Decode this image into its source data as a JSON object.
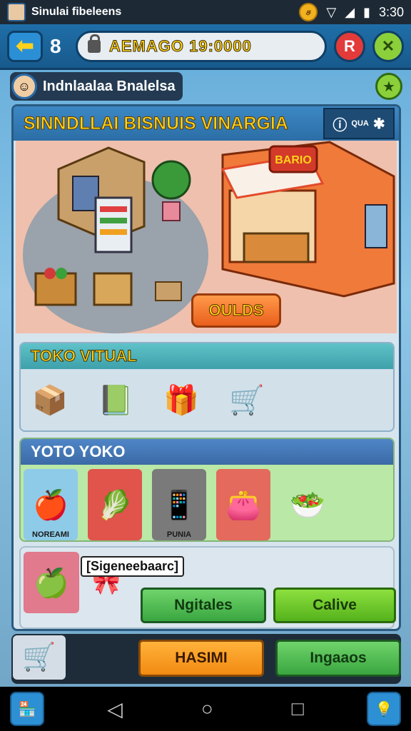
{
  "status_bar": {
    "title": "Sinulai fibeleens",
    "badge": "ச",
    "time": "3:30",
    "icons": [
      "wifi-icon",
      "signal-icon",
      "battery-icon"
    ]
  },
  "top_bar": {
    "level": "8",
    "money": "AEMAGO 19:0000",
    "right_badge": "R",
    "close_glyph": "✕"
  },
  "player": {
    "name": "Indnlaalaa Bnalelsa"
  },
  "shop": {
    "title": "SINNDLLAI BISNUIS VINARGIA",
    "badge_label": "QUA",
    "build_label": "OULDS",
    "sign_text": "BARIO"
  },
  "section_virtual": {
    "title": "TOKO VITUAL",
    "items": [
      "box-icon",
      "crate-icon",
      "gift-basket-icon",
      "shopping-cart-icon"
    ]
  },
  "section_toko": {
    "title": "YOTO YOKO",
    "cards": [
      {
        "label": "NOREAMI",
        "icon": "produce-shelf-icon",
        "color": "#8ecbe8"
      },
      {
        "label": "",
        "icon": "produce-crate-icon",
        "color": "#e0544c"
      },
      {
        "label": "PUNIA",
        "icon": "phone-icon",
        "color": "#7a7a7a"
      },
      {
        "label": "",
        "icon": "wallet-icon",
        "color": "#e36a5c"
      },
      {
        "label": "",
        "icon": "bowl-icon",
        "color": "transparent"
      }
    ]
  },
  "section_selected": {
    "label": "[Sigeneebaarc]",
    "btn_a": "Ngitales",
    "btn_b": "Calive"
  },
  "bottom_bar": {
    "btn_orange": "HASIMI",
    "btn_green": "Ingaaos"
  },
  "colors": {
    "accent_yellow": "#ffd21a",
    "header_blue": "#2c6ea6",
    "build_orange": "#ea5f1c"
  }
}
